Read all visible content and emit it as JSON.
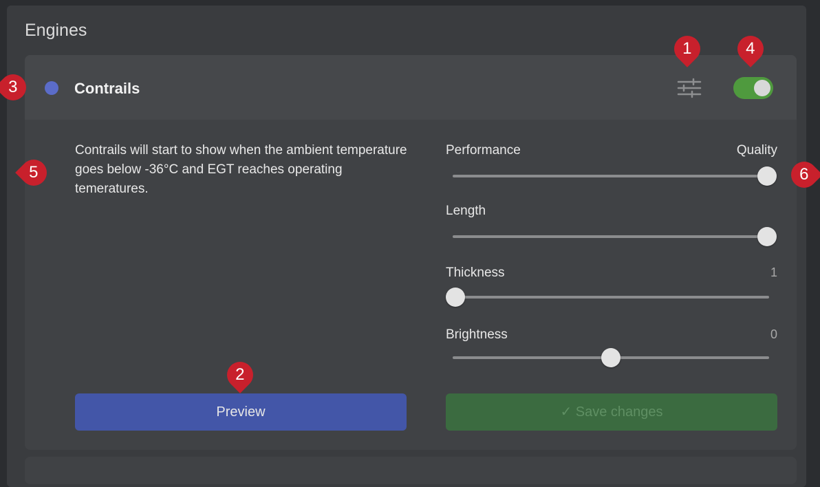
{
  "section": {
    "title": "Engines"
  },
  "card": {
    "title": "Contrails",
    "status_color": "#5b6cc8",
    "settings_icon": "sliders-icon",
    "toggle_on": true,
    "description": "Contrails will start to show when the ambient temperature goes below -36°C and EGT reaches operating temeratures."
  },
  "sliders": {
    "quality": {
      "left_label": "Performance",
      "right_label": "Quality",
      "value_fraction": 1.0
    },
    "length": {
      "label": "Length",
      "value_fraction": 1.0
    },
    "thickness": {
      "label": "Thickness",
      "value": "1",
      "value_fraction": 0.0
    },
    "brightness": {
      "label": "Brightness",
      "value": "0",
      "value_fraction": 0.5
    }
  },
  "buttons": {
    "preview": "Preview",
    "save": "✓ Save changes"
  },
  "markers": [
    "1",
    "2",
    "3",
    "4",
    "5",
    "6"
  ],
  "colors": {
    "accent": "#4356a8",
    "toggle": "#4f9a3e",
    "save_disabled": "#3b6b40",
    "marker": "#c8202c"
  }
}
